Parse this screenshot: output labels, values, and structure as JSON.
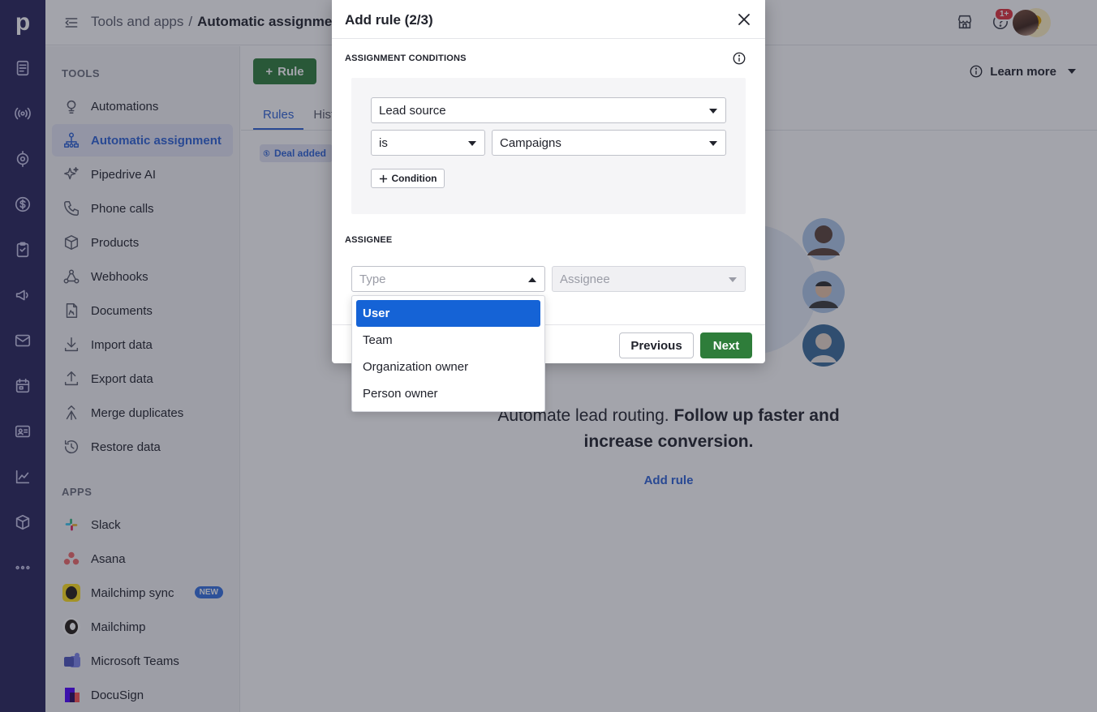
{
  "topbar": {
    "crumb_parent": "Tools and apps",
    "crumb_sep": "/",
    "crumb_current": "Automatic assignment",
    "notification_count": "1+"
  },
  "sidebar": {
    "tools_title": "TOOLS",
    "apps_title": "APPS",
    "tools": [
      {
        "label": "Automations",
        "icon": "automations-icon"
      },
      {
        "label": "Automatic assignment",
        "icon": "assignment-icon",
        "active": true
      },
      {
        "label": "Pipedrive AI",
        "icon": "sparkle-icon"
      },
      {
        "label": "Phone calls",
        "icon": "phone-icon"
      },
      {
        "label": "Products",
        "icon": "box-icon"
      },
      {
        "label": "Webhooks",
        "icon": "webhook-icon"
      },
      {
        "label": "Documents",
        "icon": "document-icon"
      },
      {
        "label": "Import data",
        "icon": "download-icon"
      },
      {
        "label": "Export data",
        "icon": "upload-icon"
      },
      {
        "label": "Merge duplicates",
        "icon": "merge-icon"
      },
      {
        "label": "Restore data",
        "icon": "restore-icon"
      }
    ],
    "apps": [
      {
        "label": "Slack",
        "icon": "slack-icon"
      },
      {
        "label": "Asana",
        "icon": "asana-icon"
      },
      {
        "label": "Mailchimp sync",
        "icon": "mailchimp-icon",
        "badge": "NEW"
      },
      {
        "label": "Mailchimp",
        "icon": "mailchimp-icon"
      },
      {
        "label": "Microsoft Teams",
        "icon": "teams-icon"
      },
      {
        "label": "DocuSign",
        "icon": "docusign-icon"
      }
    ]
  },
  "main": {
    "rule_button": "Rule",
    "learn_more": "Learn more",
    "tabs": [
      "Rules",
      "Hist"
    ],
    "deal_chip": "Deal added",
    "empty_text_plain": "Automate lead routing. ",
    "empty_text_bold": "Follow up faster and increase conversion.",
    "add_rule_link": "Add rule"
  },
  "modal": {
    "title": "Add rule (2/3)",
    "conditions_title": "ASSIGNMENT CONDITIONS",
    "field_value": "Lead source",
    "operator_value": "is",
    "condition_value": "Campaigns",
    "add_condition_label": "Condition",
    "assignee_title": "ASSIGNEE",
    "type_placeholder": "Type",
    "assignee_placeholder": "Assignee",
    "previous_label": "Previous",
    "next_label": "Next"
  },
  "type_dropdown": {
    "options": [
      "User",
      "Team",
      "Organization owner",
      "Person owner"
    ],
    "selected": "User"
  },
  "colors": {
    "rail": "#26235a",
    "accent_blue": "#2d62d6",
    "green": "#2e7d3a",
    "selected_option": "#1563d6"
  }
}
